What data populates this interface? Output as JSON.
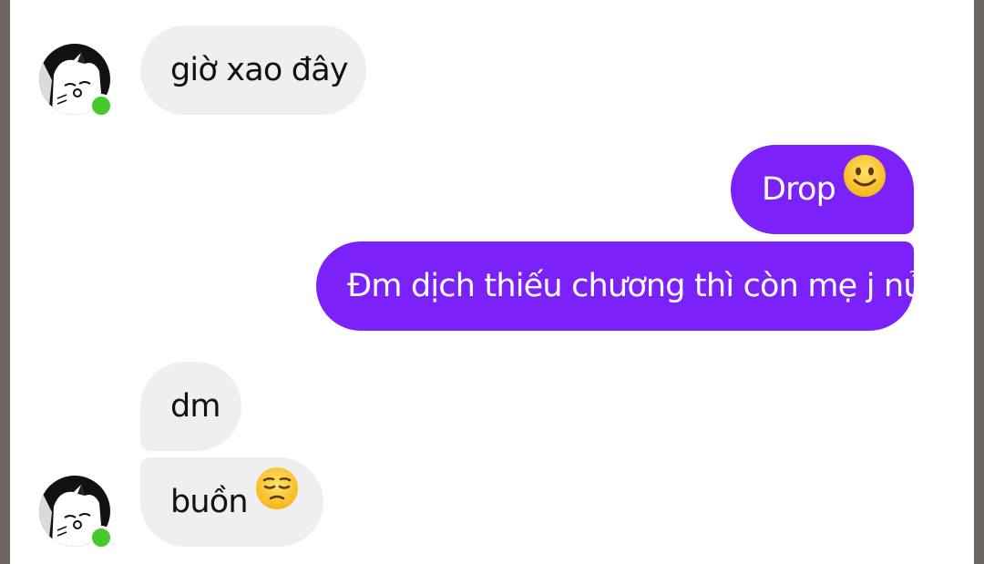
{
  "conversation": {
    "messages": [
      {
        "sender": "them",
        "text": "giờ xao đây"
      },
      {
        "sender": "me",
        "text": "Drop",
        "emoji": "slightly-smiling-face-icon"
      },
      {
        "sender": "me",
        "text": "Đm dịch thiếu chương thì còn mẹ j nửa"
      },
      {
        "sender": "them",
        "text": "dm"
      },
      {
        "sender": "them",
        "text": "buồn",
        "emoji": "pensive-face-icon"
      }
    ]
  },
  "contact": {
    "status": "online"
  },
  "colors": {
    "outgoing_bubble": "#7b22fb",
    "incoming_bubble": "#efefef",
    "online_dot": "#45c92d",
    "frame": "#6b6563"
  }
}
